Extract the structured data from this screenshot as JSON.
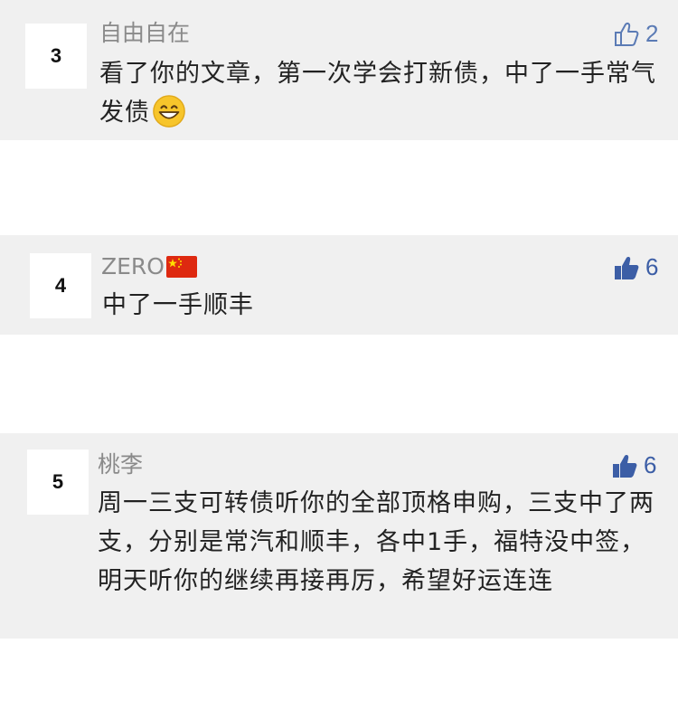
{
  "comments": [
    {
      "rank": "3",
      "author": "自由自在",
      "likes": "2",
      "liked": false,
      "text": "看了你的文章，第一次学会打新债，中了一手常气发债",
      "emoji": "grinning-face-icon"
    },
    {
      "rank": "4",
      "author": "ZERO",
      "author_flag": "china-flag-icon",
      "likes": "6",
      "liked": true,
      "text": "中了一手顺丰"
    },
    {
      "rank": "5",
      "author": "桃李",
      "likes": "6",
      "liked": true,
      "text": "周一三支可转债听你的全部顶格申购，三支中了两支，分别是常汽和顺丰，各中1手，福特没中签，明天听你的继续再接再厉，希望好运连连"
    }
  ],
  "colors": {
    "card_bg": "#f0f0f0",
    "like_outline": "#5b7bb5",
    "like_filled": "#3c5ea6",
    "author_text": "#8a8a8a",
    "body_text": "#222222"
  }
}
